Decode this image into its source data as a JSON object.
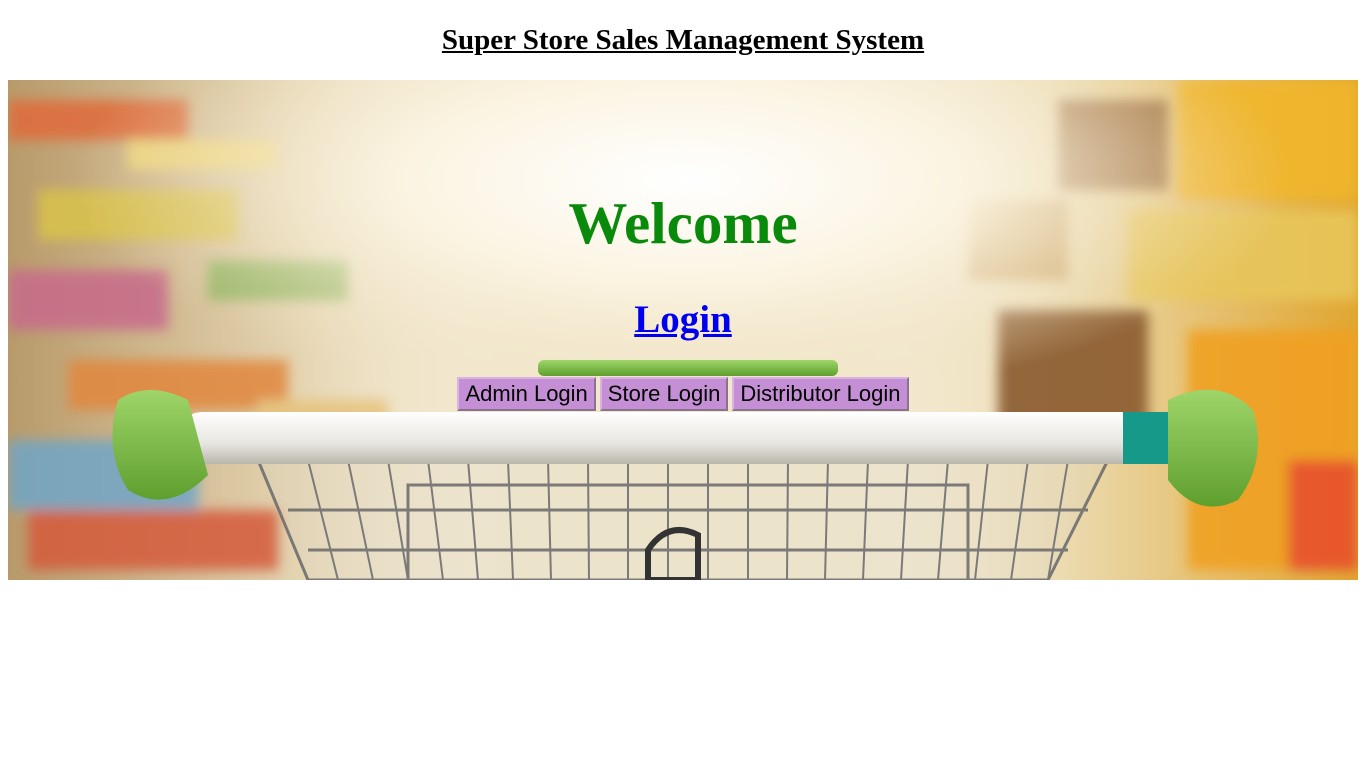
{
  "header": {
    "title": "Super Store Sales Management System"
  },
  "hero": {
    "image": "supermarket-aisle-shopping-cart",
    "welcome": "Welcome",
    "login_label": "Login",
    "buttons": {
      "admin": "Admin Login",
      "store": "Store Login",
      "distributor": "Distributor Login"
    }
  },
  "colors": {
    "welcome": "#0a8a0a",
    "link": "#0000ee",
    "button_bg": "#c58fd6"
  }
}
